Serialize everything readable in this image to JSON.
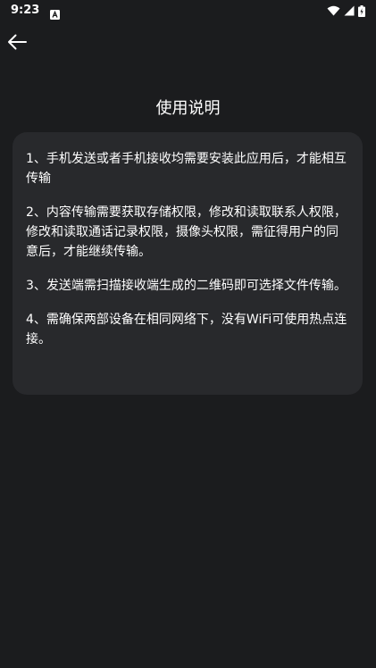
{
  "status_bar": {
    "time": "9:23",
    "left_icon": "notification-a-icon",
    "right_icons": [
      "wifi-icon",
      "cellular-signal-icon",
      "battery-charging-icon"
    ]
  },
  "nav": {
    "back_icon": "arrow-left-icon"
  },
  "page": {
    "title": "使用说明"
  },
  "instructions": [
    "1、手机发送或者手机接收均需要安装此应用后，才能相互传输",
    "2、内容传输需要获取存储权限，修改和读取联系人权限，修改和读取通话记录权限，摄像头权限，需征得用户的同意后，才能继续传输。",
    "3、发送端需扫描接收端生成的二维码即可选择文件传输。",
    "4、需确保两部设备在相同网络下，没有WiFi可使用热点连接。"
  ],
  "colors": {
    "background": "#1b1c1e",
    "card": "#28292c",
    "text": "#ffffff"
  }
}
